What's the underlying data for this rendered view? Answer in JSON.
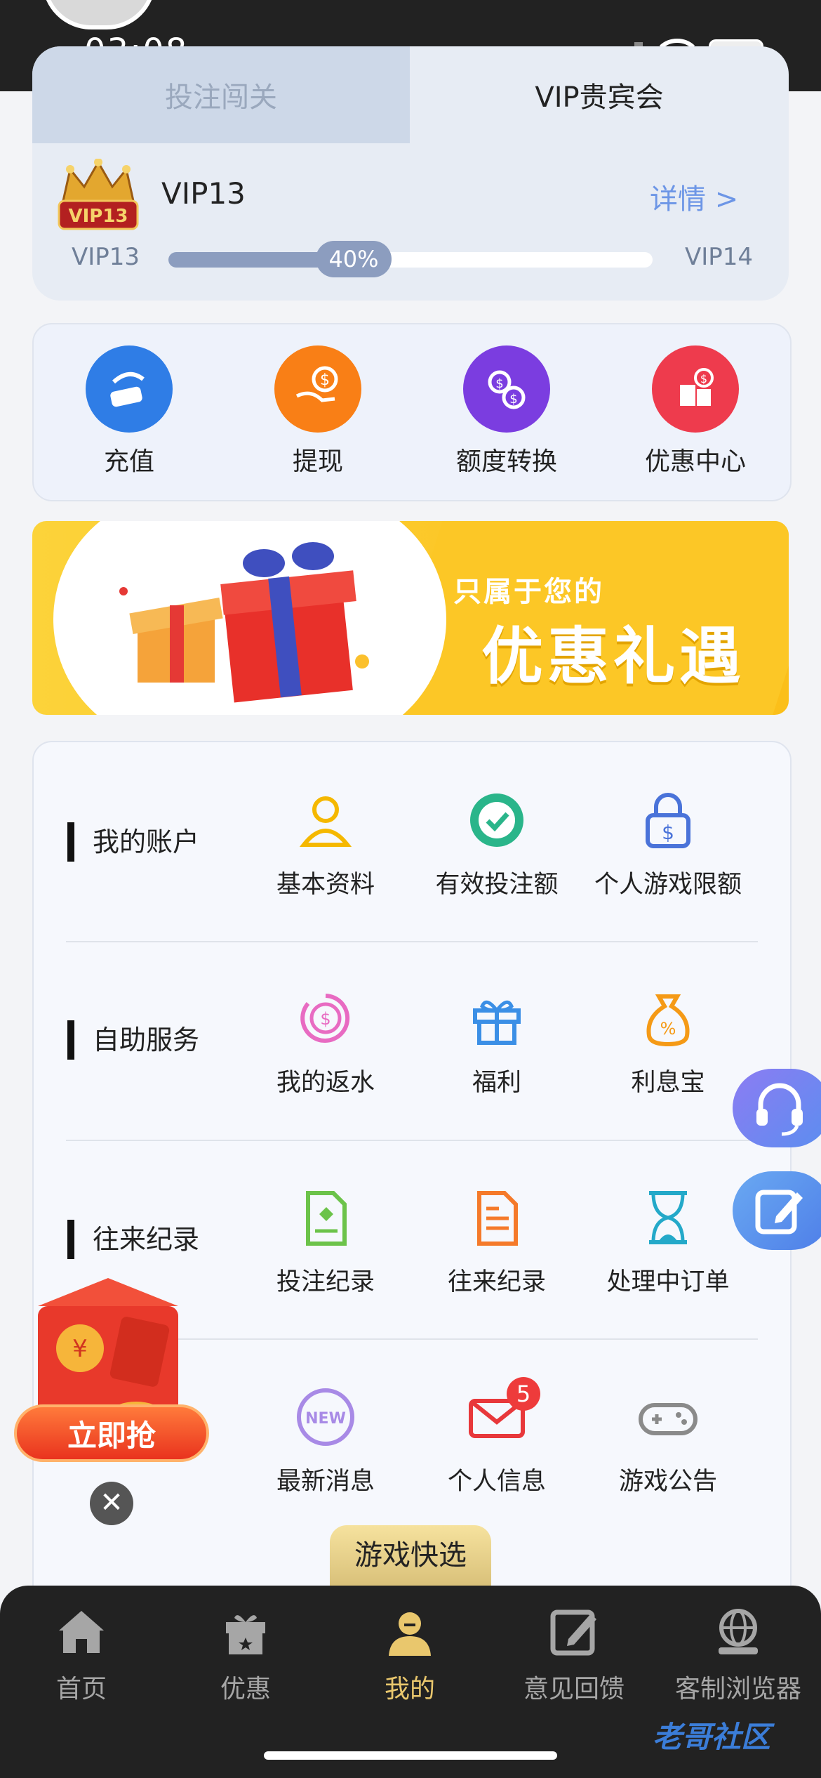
{
  "status": {
    "time": "03:08",
    "battery": "77"
  },
  "vip": {
    "tabs": [
      "投注闯关",
      "VIP贵宾会"
    ],
    "badge_text": "VIP13",
    "level": "VIP13",
    "detail_link": "详情 >",
    "current_level": "VIP13",
    "next_level": "VIP14",
    "progress_label": "40%",
    "progress": 0.4
  },
  "quick_actions": [
    {
      "label": "充值",
      "icon": "deposit-icon",
      "color": "#2f7de6"
    },
    {
      "label": "提现",
      "icon": "withdraw-icon",
      "color": "#f97f16"
    },
    {
      "label": "额度转换",
      "icon": "transfer-icon",
      "color": "#7b3de0"
    },
    {
      "label": "优惠中心",
      "icon": "promo-center-icon",
      "color": "#ee3b4d"
    }
  ],
  "banner": {
    "subtitle": "只属于您的",
    "title": "优惠礼遇"
  },
  "menu": {
    "sections": [
      {
        "title": "我的账户",
        "items": [
          {
            "label": "基本资料",
            "icon": "user-profile-icon"
          },
          {
            "label": "有效投注额",
            "icon": "chip-check-icon"
          },
          {
            "label": "个人游戏限额",
            "icon": "lock-dollar-icon"
          }
        ]
      },
      {
        "title": "自助服务",
        "items": [
          {
            "label": "我的返水",
            "icon": "rebate-icon"
          },
          {
            "label": "福利",
            "icon": "gift-icon"
          },
          {
            "label": "利息宝",
            "icon": "money-bag-icon"
          }
        ]
      },
      {
        "title": "往来纪录",
        "items": [
          {
            "label": "投注纪录",
            "icon": "bet-record-icon"
          },
          {
            "label": "往来纪录",
            "icon": "transaction-record-icon"
          },
          {
            "label": "处理中订单",
            "icon": "hourglass-icon"
          }
        ]
      },
      {
        "title": "",
        "items": [
          {
            "label": "最新消息",
            "icon": "new-badge-icon"
          },
          {
            "label": "个人信息",
            "icon": "mail-icon",
            "badge": "5"
          },
          {
            "label": "游戏公告",
            "icon": "gamepad-icon"
          }
        ]
      }
    ],
    "quick_pick": "游戏快选"
  },
  "promo": {
    "button": "立即抢",
    "close": "✕"
  },
  "tabbar": [
    {
      "label": "首页",
      "icon": "home-icon"
    },
    {
      "label": "优惠",
      "icon": "gift-star-icon"
    },
    {
      "label": "我的",
      "icon": "profile-icon",
      "active": true
    },
    {
      "label": "意见回馈",
      "icon": "feedback-icon"
    },
    {
      "label": "客制浏览器",
      "icon": "globe-icon"
    }
  ],
  "watermark": "老哥社区"
}
